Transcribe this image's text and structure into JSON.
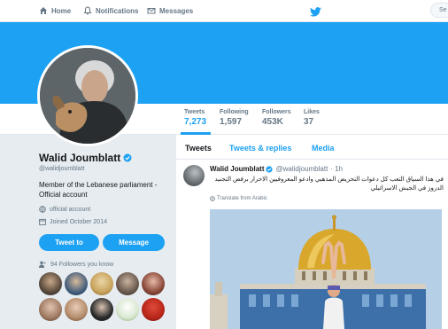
{
  "nav": {
    "home": "Home",
    "notifications": "Notifications",
    "messages": "Messages",
    "search_placeholder": "Se"
  },
  "stats": [
    {
      "label": "Tweets",
      "value": "7,273"
    },
    {
      "label": "Following",
      "value": "1,597"
    },
    {
      "label": "Followers",
      "value": "453K"
    },
    {
      "label": "Likes",
      "value": "37"
    }
  ],
  "profile": {
    "name": "Walid Joumblatt",
    "handle": "@walidjoumblatt",
    "bio": "Member of the Lebanese parliament - Official account",
    "website": "official account",
    "joined": "Joined October 2014",
    "tweet_to_label": "Tweet to",
    "message_label": "Message",
    "followers_you_know": "94 Followers you know"
  },
  "timeline": {
    "tabs": [
      "Tweets",
      "Tweets & replies",
      "Media"
    ],
    "tweet": {
      "name": "Walid Joumblatt",
      "handle": "@walidjoumblatt",
      "time": "· 1h",
      "text": "في هذا السياق التعب كل دعوات التحريض المذهبي وادعو المعروفيين الاحرار برفض التجنيد الدروز في الجيش الاسرائيلي",
      "translate": "Translate from Arabic"
    }
  },
  "colors": {
    "accent": "#1da1f2",
    "banner": "#1da1f2",
    "background": "#e6ecf0"
  }
}
